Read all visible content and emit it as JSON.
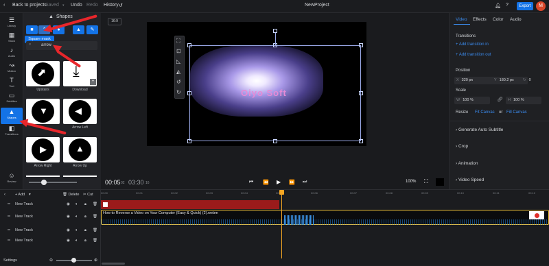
{
  "topbar": {
    "back_label": "Back to projects",
    "saved": "Saved",
    "undo": "Undo",
    "redo": "Redo",
    "history": "History",
    "project_name": "NewProject",
    "export": "Export",
    "avatar": "M"
  },
  "leftnav": [
    "Library",
    "Stock",
    "Audio",
    "Motion",
    "Text",
    "Subtitles",
    "Shapes",
    "Transitions",
    "Review"
  ],
  "panel": {
    "title": "Shapes",
    "tooltip": "Square mask",
    "search_value": "arrow",
    "tiles": [
      {
        "label": "Upstairs",
        "glyph": "⬈"
      },
      {
        "label": "Download",
        "glyph": "⤓"
      },
      {
        "label": "",
        "glyph": "▼"
      },
      {
        "label": "Arrow Left",
        "glyph": "◀"
      },
      {
        "label": "Arrow Right",
        "glyph": "▶"
      },
      {
        "label": "Arrow Up",
        "glyph": "▲"
      }
    ]
  },
  "stage": {
    "aspect": "16:9",
    "canvas_text": "Oiyo Soft",
    "time_current": "00:05",
    "time_current_frames": "02",
    "time_total": "03:30",
    "time_total_frames": "16",
    "zoom": "100%"
  },
  "props": {
    "tabs": [
      "Video",
      "Effects",
      "Color",
      "Audio"
    ],
    "transitions_heading": "Transitions",
    "add_in": "+ Add transition in",
    "add_out": "+ Add transition out",
    "position_heading": "Position",
    "x_label": "X",
    "x_value": "320 px",
    "y_label": "Y",
    "y_value": "180.2 px",
    "scale_heading": "Scale",
    "w_label": "W",
    "w_value": "100 %",
    "h_label": "H",
    "h_value": "100 %",
    "angle_value": "0",
    "resize_label": "Resize",
    "fit_canvas": "Fit Canvas",
    "or": "or",
    "fill_canvas": "Fill Canvas",
    "sections": [
      "Generate Auto Subtitle",
      "Crop",
      "Animation",
      "Video Speed"
    ]
  },
  "timeline": {
    "add": "+ Add",
    "delete": "Delete",
    "cut": "Cut",
    "ruler": [
      "00:00",
      "00:01",
      "00:02",
      "00:03",
      "00:04",
      "00:05",
      "00:06",
      "00:07",
      "00:08",
      "00:09",
      "00:10",
      "00:11",
      "00:12"
    ],
    "tracks": [
      "New Track",
      "New Track",
      "New Track",
      "New Track",
      "New Track"
    ],
    "clip_label": "How to Reverse a Video on Your Computer (Easy & Quick) (2).webm",
    "settings": "Settings"
  },
  "colors": {
    "accent": "#1473e6",
    "export": "#1473e6",
    "avatar": "#d9472b",
    "playhead": "#f5a623",
    "red_track": "#9b1b1b",
    "arrow": "#e8262b"
  }
}
